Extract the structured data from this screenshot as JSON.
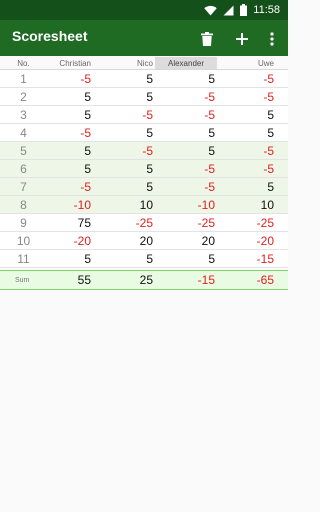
{
  "status": {
    "time": "11:58"
  },
  "appbar": {
    "title": "Scoresheet"
  },
  "headers": [
    "No.",
    "Christian",
    "Nico",
    "Alexander",
    "Uwe"
  ],
  "rows": [
    {
      "no": "1",
      "values": [
        "-5",
        "5",
        "5",
        "-5"
      ]
    },
    {
      "no": "2",
      "values": [
        "5",
        "5",
        "-5",
        "-5"
      ]
    },
    {
      "no": "3",
      "values": [
        "5",
        "-5",
        "-5",
        "5"
      ]
    },
    {
      "no": "4",
      "values": [
        "-5",
        "5",
        "5",
        "5"
      ]
    },
    {
      "no": "5",
      "values": [
        "5",
        "-5",
        "5",
        "-5"
      ]
    },
    {
      "no": "6",
      "values": [
        "5",
        "5",
        "-5",
        "-5"
      ]
    },
    {
      "no": "7",
      "values": [
        "-5",
        "5",
        "-5",
        "5"
      ]
    },
    {
      "no": "8",
      "values": [
        "-10",
        "10",
        "-10",
        "10"
      ]
    },
    {
      "no": "9",
      "values": [
        "75",
        "-25",
        "-25",
        "-25"
      ]
    },
    {
      "no": "10",
      "values": [
        "-20",
        "20",
        "20",
        "-20"
      ]
    },
    {
      "no": "11",
      "values": [
        "5",
        "5",
        "5",
        "-15"
      ]
    }
  ],
  "sum": {
    "label": "Sum",
    "values": [
      "55",
      "25",
      "-15",
      "-65"
    ]
  },
  "colors": {
    "appbar": "#1f6b24",
    "statusbar": "#14501a",
    "negative": "#e02020",
    "sum_border": "#7ed56a"
  }
}
